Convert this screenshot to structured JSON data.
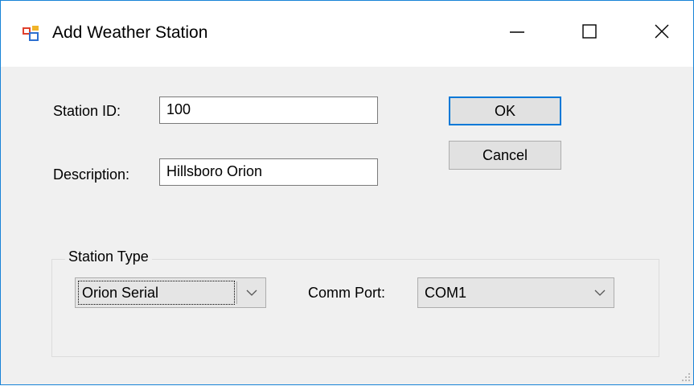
{
  "window": {
    "title": "Add Weather Station"
  },
  "form": {
    "station_id_label": "Station ID:",
    "station_id_value": "100",
    "description_label": "Description:",
    "description_value": "Hillsboro Orion"
  },
  "buttons": {
    "ok_label": "OK",
    "cancel_label": "Cancel"
  },
  "station_type": {
    "group_label": "Station Type",
    "type_selected": "Orion Serial",
    "comm_port_label": "Comm Port:",
    "comm_port_selected": "COM1"
  },
  "icons": {
    "app": "app-window-icon",
    "minimize": "minimize-icon",
    "maximize": "maximize-icon",
    "close": "close-icon",
    "dropdown": "chevron-down-icon",
    "resize": "resize-grip-icon"
  },
  "colors": {
    "window_border": "#1883d7",
    "focus_border": "#0078d7",
    "dialog_background": "#f0f0f0",
    "titlebar_background": "#ffffff"
  }
}
